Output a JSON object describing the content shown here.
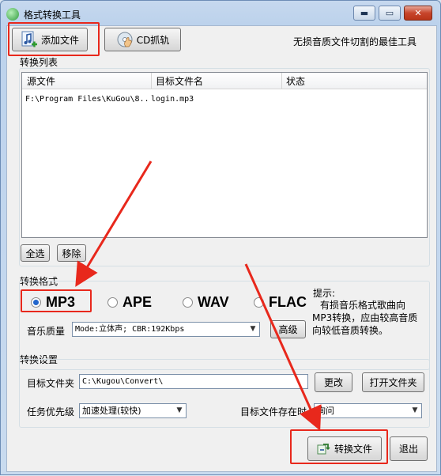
{
  "window": {
    "title": "格式转换工具",
    "minimize_glyph": "▬",
    "maximize_glyph": "▭",
    "close_glyph": "✕"
  },
  "toolbar": {
    "add_file_label": "添加文件",
    "cd_rip_label": "CD抓轨",
    "tagline": "无损音质文件切割的最佳工具"
  },
  "convert_list": {
    "title": "转换列表",
    "columns": [
      "源文件",
      "目标文件名",
      "状态"
    ],
    "rows": [
      {
        "source": "F:\\Program Files\\KuGou\\8..",
        "target": "login.mp3",
        "status": ""
      }
    ],
    "select_all_label": "全选",
    "remove_label": "移除"
  },
  "format": {
    "title": "转换格式",
    "options": [
      "MP3",
      "APE",
      "WAV",
      "FLAC"
    ],
    "selected": "MP3",
    "quality_label": "音乐质量",
    "quality_value": "Mode:立体声; CBR:192Kbps",
    "advanced_label": "高级",
    "hint_title": "提示:",
    "hint_text": "有损音乐格式歌曲向MP3转换，应由较高音质向较低音质转换。"
  },
  "settings": {
    "title": "转换设置",
    "target_folder_label": "目标文件夹",
    "target_folder_value": "C:\\Kugou\\Convert\\",
    "change_label": "更改",
    "open_folder_label": "打开文件夹",
    "priority_label": "任务优先级",
    "priority_value": "加速处理(较快)",
    "exists_label": "目标文件存在时",
    "exists_value": "询问"
  },
  "actions": {
    "convert_label": "转换文件",
    "exit_label": "退出"
  },
  "colors": {
    "highlight": "#e8281c",
    "arrow": "#e8281c"
  },
  "icons": {
    "add_file": "music-note-add-icon",
    "cd": "cd-hand-icon",
    "convert": "convert-arrows-icon"
  }
}
